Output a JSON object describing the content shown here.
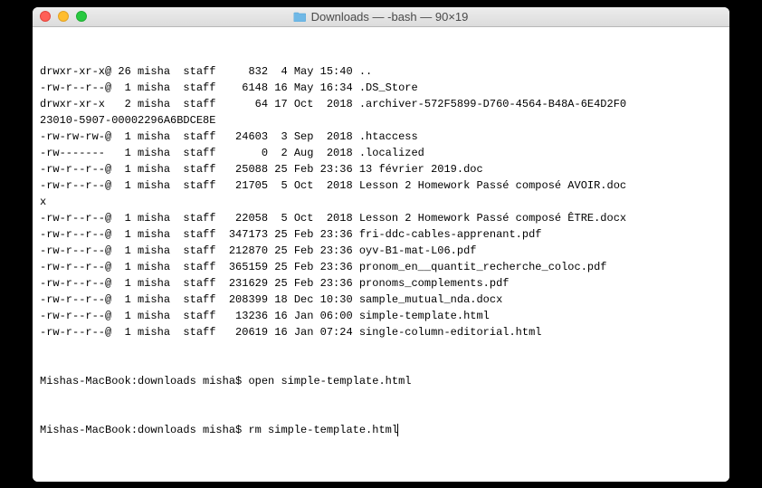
{
  "window": {
    "title": "Downloads — -bash — 90×19"
  },
  "terminal": {
    "lines": [
      "drwxr-xr-x@ 26 misha  staff     832  4 May 15:40 ..",
      "-rw-r--r--@  1 misha  staff    6148 16 May 16:34 .DS_Store",
      "drwxr-xr-x   2 misha  staff      64 17 Oct  2018 .archiver-572F5899-D760-4564-B48A-6E4D2F0",
      "23010-5907-00002296A6BDCE8E",
      "-rw-rw-rw-@  1 misha  staff   24603  3 Sep  2018 .htaccess",
      "-rw-------   1 misha  staff       0  2 Aug  2018 .localized",
      "-rw-r--r--@  1 misha  staff   25088 25 Feb 23:36 13 février 2019.doc",
      "-rw-r--r--@  1 misha  staff   21705  5 Oct  2018 Lesson 2 Homework Passé composé AVOIR.doc",
      "x",
      "-rw-r--r--@  1 misha  staff   22058  5 Oct  2018 Lesson 2 Homework Passé composé ÊTRE.docx",
      "-rw-r--r--@  1 misha  staff  347173 25 Feb 23:36 fri-ddc-cables-apprenant.pdf",
      "-rw-r--r--@  1 misha  staff  212870 25 Feb 23:36 oyv-B1-mat-L06.pdf",
      "-rw-r--r--@  1 misha  staff  365159 25 Feb 23:36 pronom_en__quantit_recherche_coloc.pdf",
      "-rw-r--r--@  1 misha  staff  231629 25 Feb 23:36 pronoms_complements.pdf",
      "-rw-r--r--@  1 misha  staff  208399 18 Dec 10:30 sample_mutual_nda.docx",
      "-rw-r--r--@  1 misha  staff   13236 16 Jan 06:00 simple-template.html",
      "-rw-r--r--@  1 misha  staff   20619 16 Jan 07:24 single-column-editorial.html"
    ],
    "prompt_prefix": "Mishas-MacBook:downloads misha$ ",
    "history": [
      "open simple-template.html"
    ],
    "current_command": "rm simple-template.html"
  }
}
